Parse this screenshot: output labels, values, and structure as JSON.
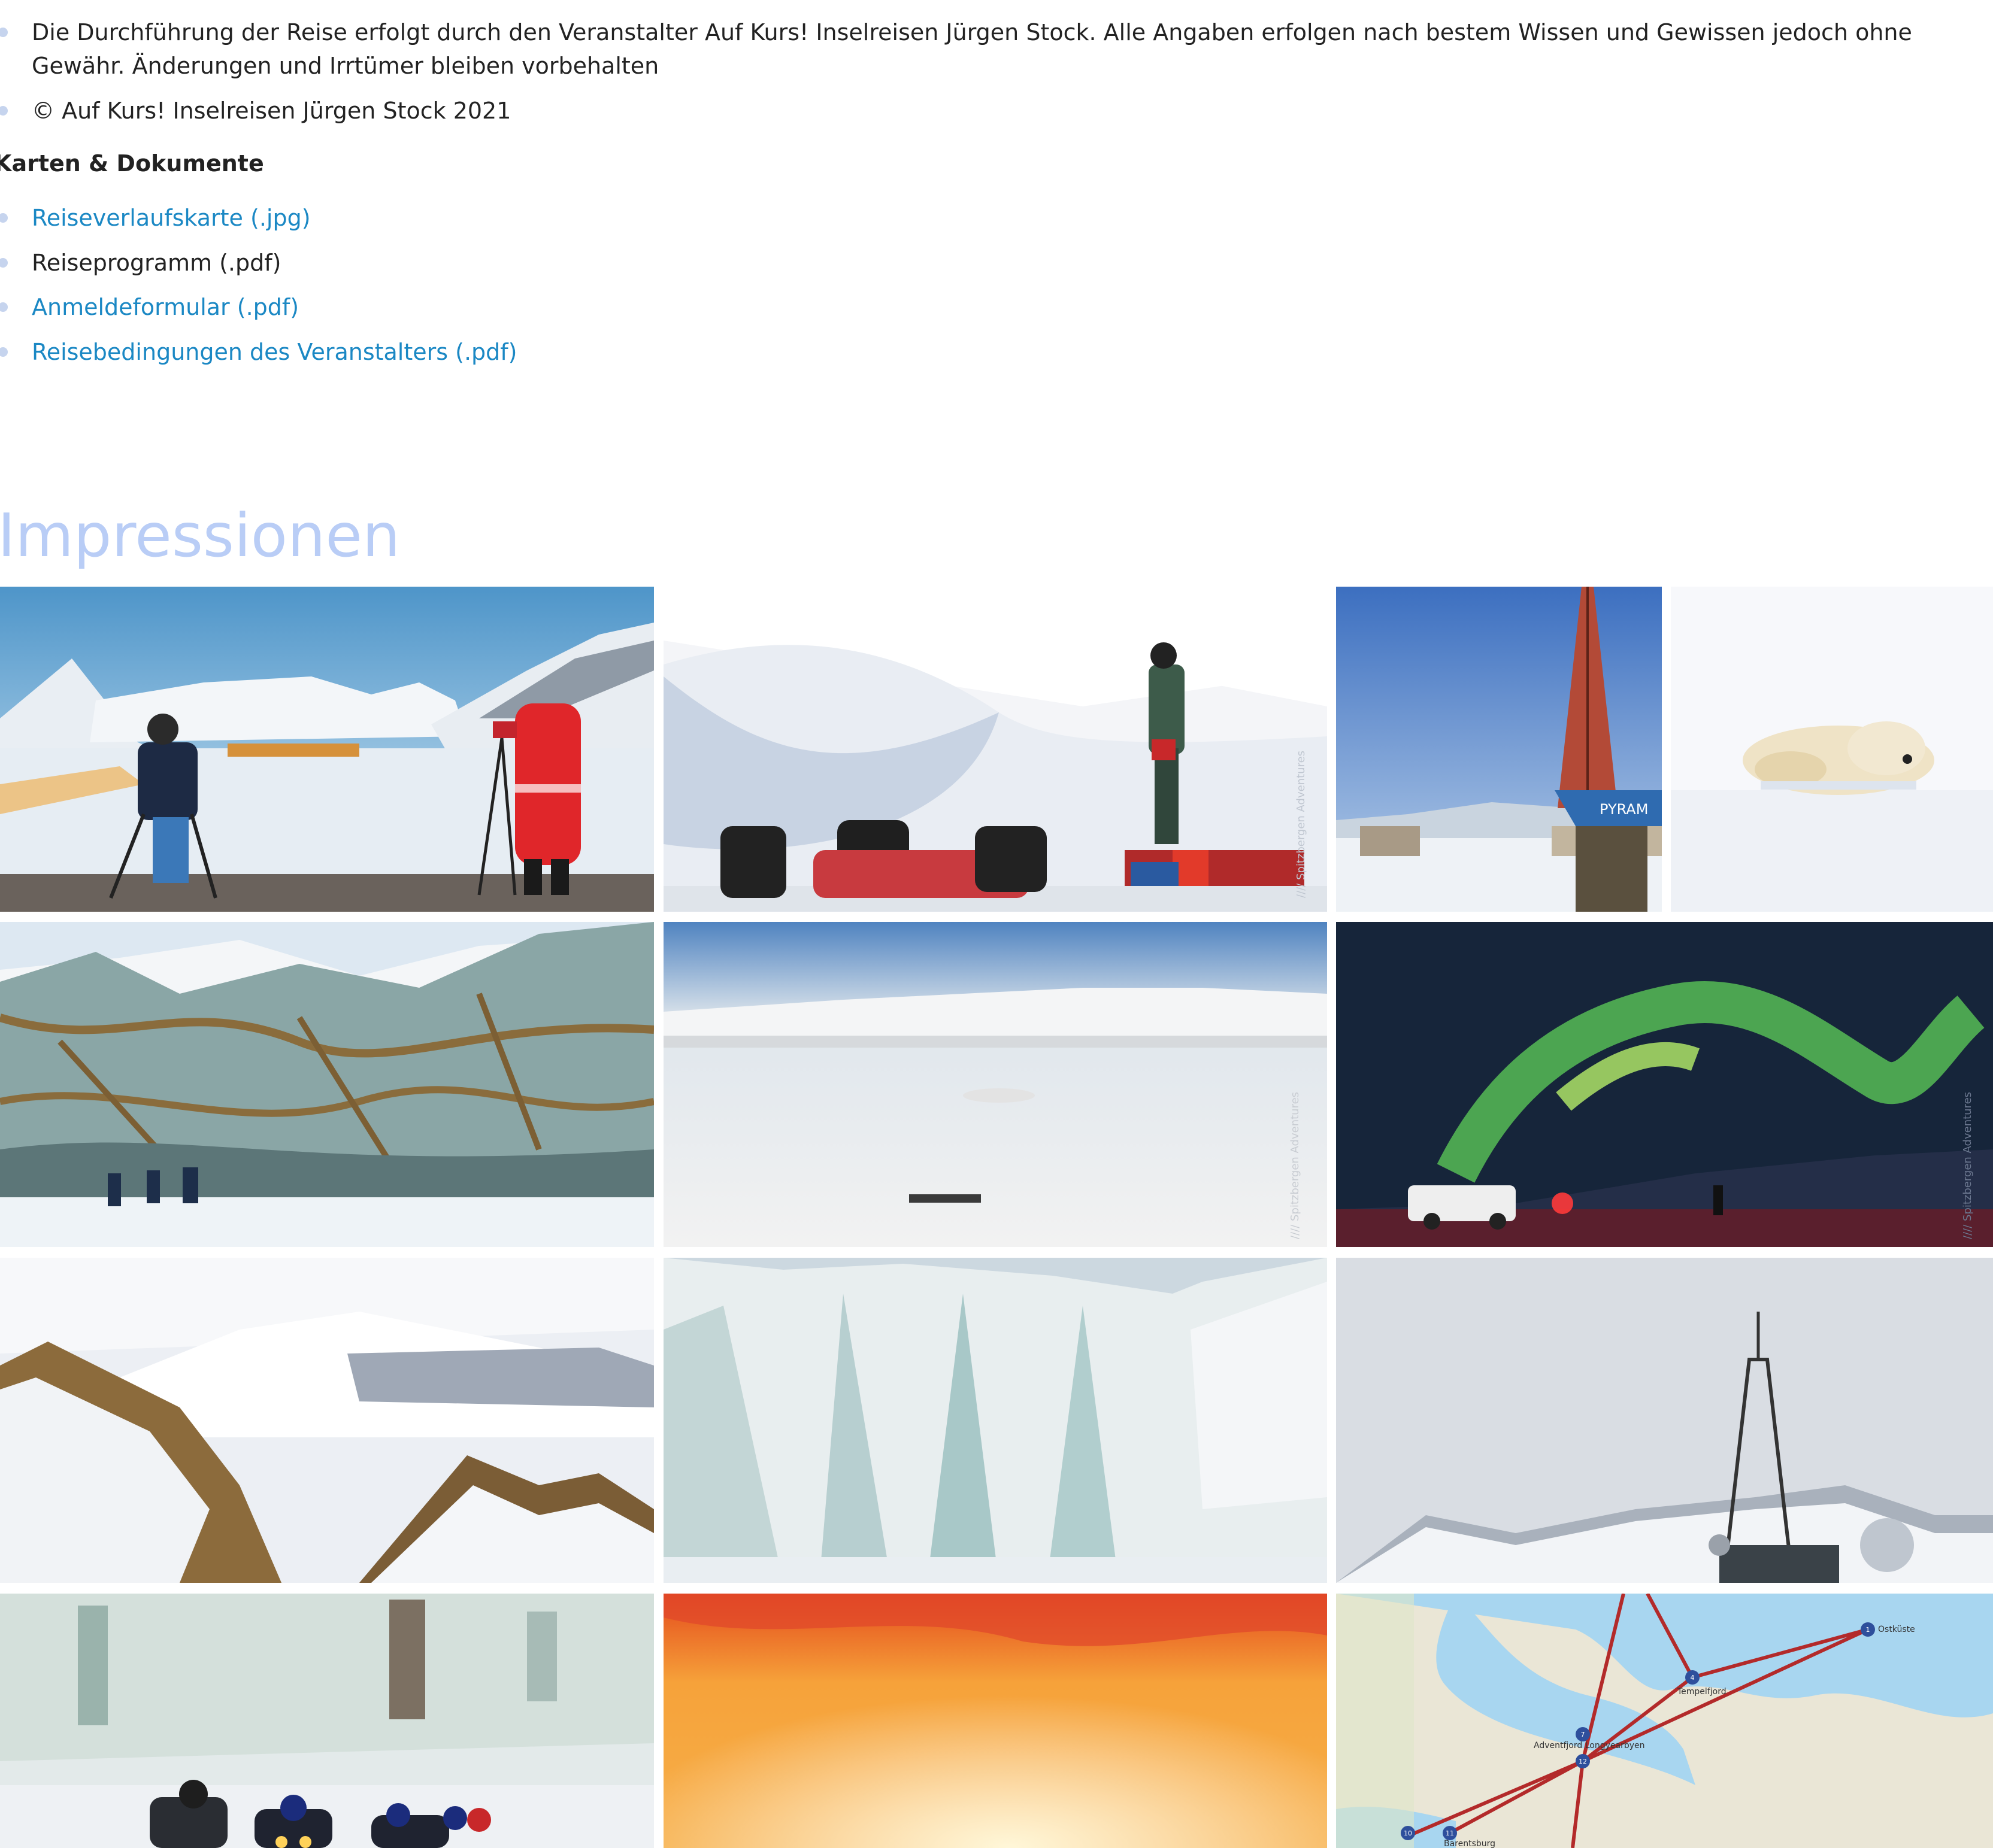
{
  "info": {
    "items": [
      "Die Durchführung der Reise erfolgt durch den Veranstalter Auf Kurs! Inselreisen Jürgen Stock. Alle Angaben erfolgen nach bestem Wissen und Gewissen jedoch ohne Gewähr. Änderungen und Irrtümer bleiben vorbehalten",
      "© Auf Kurs! Inselreisen Jürgen Stock 2021"
    ]
  },
  "documents": {
    "heading": "Karten & Dokumente",
    "items": [
      {
        "label": "Reiseverlaufskarte (.jpg)",
        "link": true
      },
      {
        "label": "Reiseprogramm (.pdf)",
        "link": false
      },
      {
        "label": "Anmeldeformular (.pdf)",
        "link": true
      },
      {
        "label": "Reisebedingungen des Veranstalters (.pdf)",
        "link": true
      }
    ]
  },
  "gallery": {
    "heading": "Impressionen",
    "watermark": "//// Spitzbergen Adventures",
    "map": {
      "labels": [
        "Ostküste",
        "Tempelfjord",
        "Adventfjord Longyearbyen",
        "Barentsburg"
      ],
      "markers": [
        "1",
        "4",
        "7",
        "10",
        "11",
        "12"
      ]
    }
  },
  "colors": {
    "link": "#1b88c4",
    "heading": "#b9cdf6",
    "bullet": "#c6d4ee"
  }
}
